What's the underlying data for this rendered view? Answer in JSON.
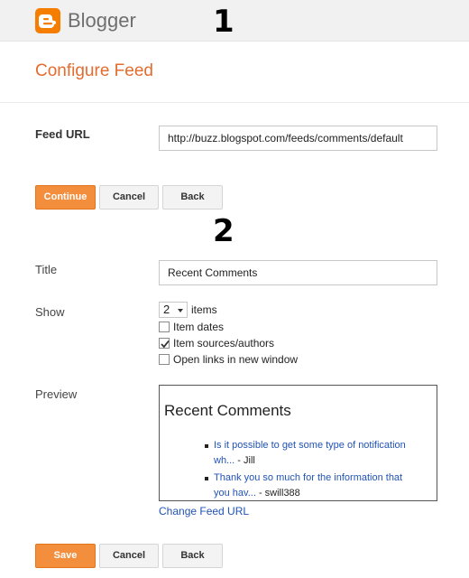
{
  "header": {
    "brand": "Blogger",
    "logo_icon": "blogger-logo-icon",
    "step_one": "1"
  },
  "page": {
    "title": "Configure Feed"
  },
  "feed_url": {
    "label": "Feed URL",
    "value": "http://buzz.blogspot.com/feeds/comments/default"
  },
  "step1_buttons": {
    "continue": "Continue",
    "cancel": "Cancel",
    "back": "Back"
  },
  "step_two": "2",
  "title_field": {
    "label": "Title",
    "value": "Recent Comments"
  },
  "show": {
    "label": "Show",
    "count": "2",
    "items_label": "items",
    "options": [
      {
        "label": "Item dates",
        "checked": false
      },
      {
        "label": "Item sources/authors",
        "checked": true
      },
      {
        "label": "Open links in new window",
        "checked": false
      }
    ]
  },
  "preview": {
    "label": "Preview",
    "heading": "Recent Comments",
    "items": [
      {
        "line1": "Is it possible to get some type of notification",
        "line2_link": "wh...",
        "line2_author": " - Jill"
      },
      {
        "line1": "Thank you so much for the information that",
        "line2_link": "you hav...",
        "line2_author": " - swill388"
      }
    ],
    "change_link": "Change Feed URL"
  },
  "step2_buttons": {
    "save": "Save",
    "cancel": "Cancel",
    "back": "Back"
  },
  "colors": {
    "accent": "#f38e3d",
    "title": "#e36c2e",
    "link": "#2153b5"
  }
}
